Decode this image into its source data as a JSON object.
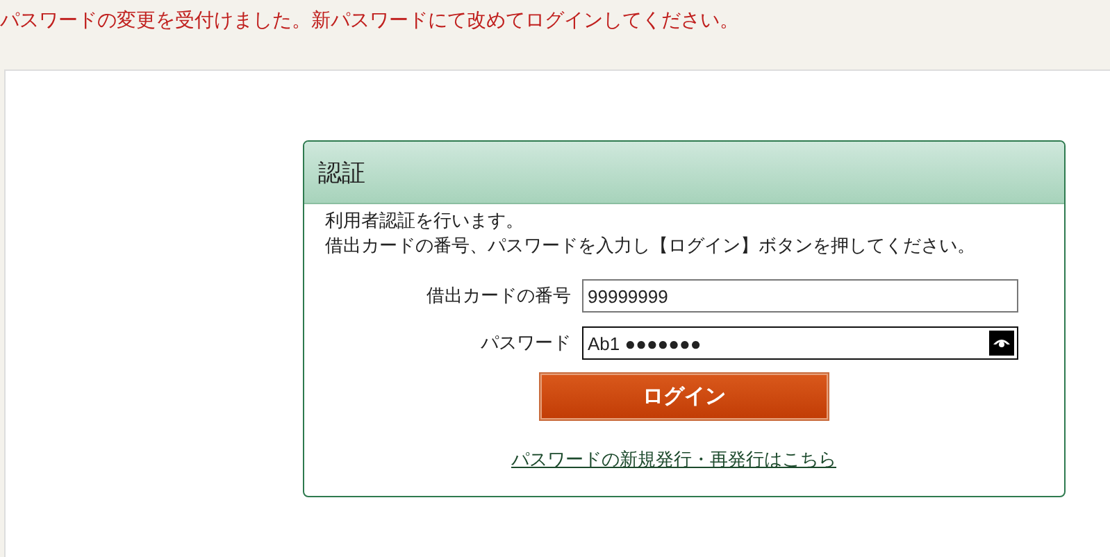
{
  "notice": "パスワードの変更を受付けました。新パスワードにて改めてログインしてください。",
  "auth": {
    "title": "認証",
    "intro": [
      "利用者認証を行います。",
      "借出カードの番号、パスワードを入力し【ログイン】ボタンを押してください。"
    ],
    "fields": [
      {
        "kind": "text",
        "label": "借出カードの番号",
        "value": "99999999"
      },
      {
        "kind": "password",
        "label": "パスワード",
        "value": "Ab1 ●●●●●●●"
      }
    ],
    "login_button": "ログイン",
    "link": "パスワードの新規発行・再発行はこちら"
  }
}
